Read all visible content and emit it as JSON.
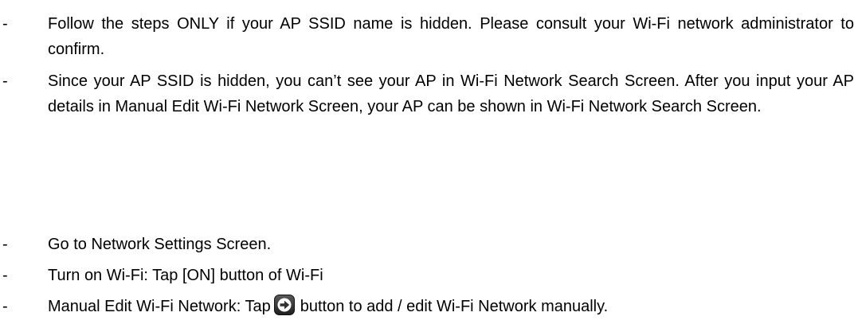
{
  "bullets": {
    "marker": "-"
  },
  "section1": {
    "item1": "Follow the steps ONLY if your AP SSID name is hidden. Please consult your Wi-Fi network administrator to confirm.",
    "item2": "Since your AP SSID is hidden, you can’t see your AP in Wi-Fi Network Search Screen. After you input your AP details in Manual Edit Wi-Fi Network Screen, your AP can be shown in Wi-Fi Network Search Screen."
  },
  "section2": {
    "item1": "Go to Network Settings Screen.",
    "item2": "Turn on Wi-Fi: Tap [ON] button of Wi-Fi",
    "item3_before_icon": "Manual Edit Wi-Fi Network: Tap",
    "item3_icon": "arrow-right-circle-icon",
    "item3_after_icon": "button to add / edit Wi-Fi Network manually."
  },
  "colors": {
    "text": "#000000",
    "icon_dark": "#333333",
    "icon_light": "#ffffff"
  }
}
